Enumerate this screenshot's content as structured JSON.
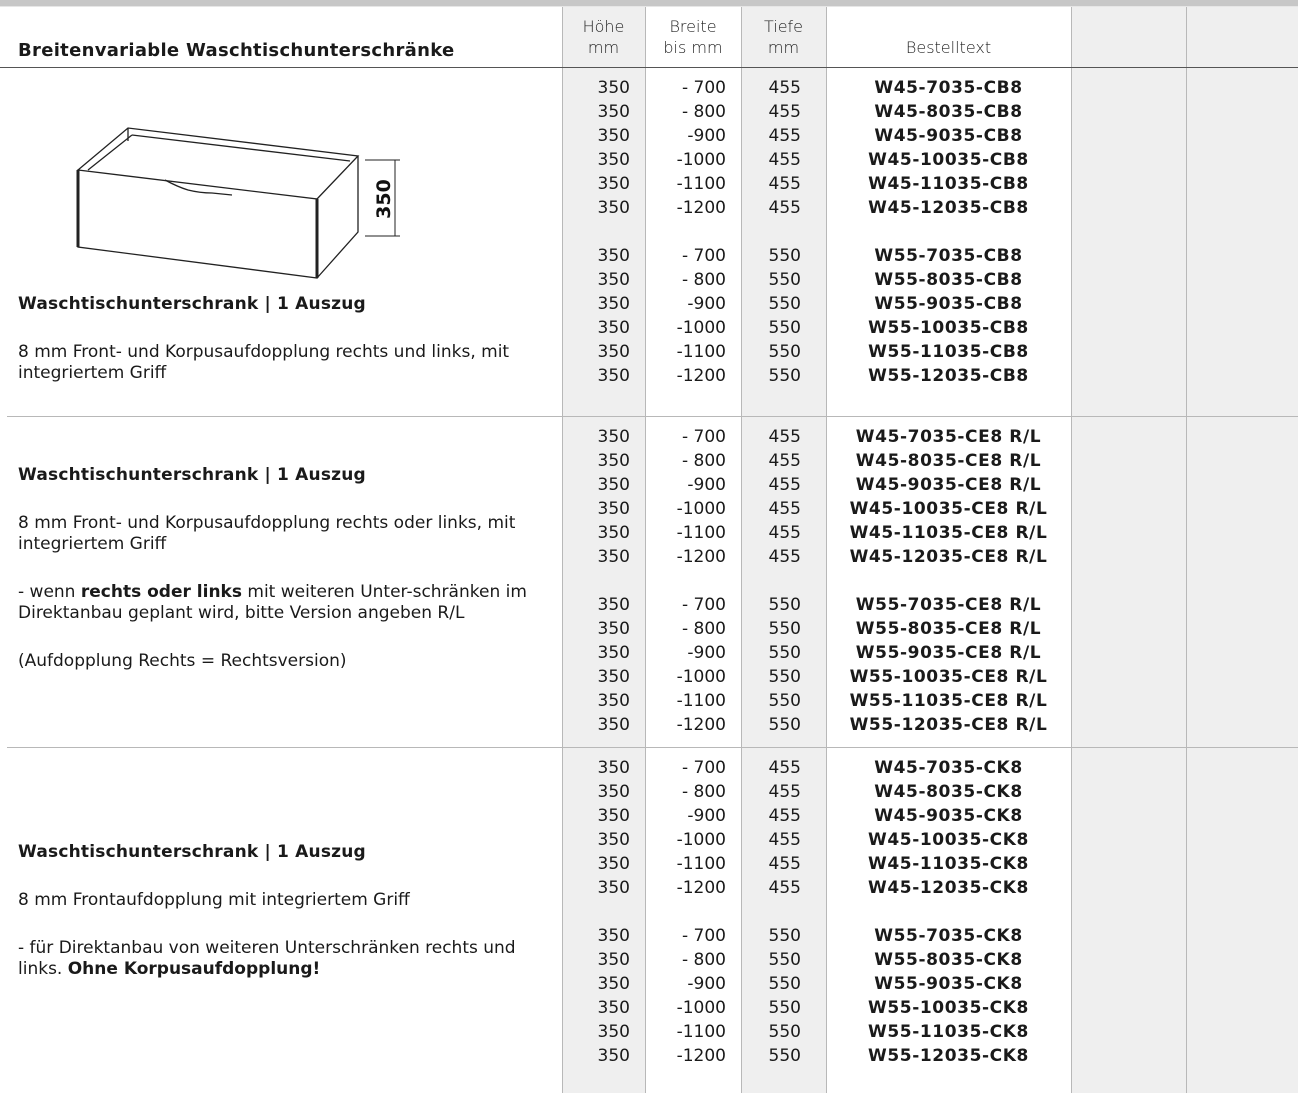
{
  "header": {
    "title": "Breitenvariable Waschtischunterschränke",
    "hoehe": [
      "Höhe",
      "mm"
    ],
    "breite": [
      "Breite",
      "bis mm"
    ],
    "tiefe": [
      "Tiefe",
      "mm"
    ],
    "bestelltext": "Bestelltext"
  },
  "drawing": {
    "dimension_label": "350"
  },
  "sections": [
    {
      "title": "Waschtischunterschrank | 1 Auszug",
      "para1": "8 mm Front- und Korpusaufdopplung rechts und links, mit integriertem Griff",
      "rows_a": [
        [
          "350",
          "- 700",
          "455",
          "W45-7035-CB8"
        ],
        [
          "350",
          "- 800",
          "455",
          "W45-8035-CB8"
        ],
        [
          "350",
          "-900",
          "455",
          "W45-9035-CB8"
        ],
        [
          "350",
          "-1000",
          "455",
          "W45-10035-CB8"
        ],
        [
          "350",
          "-1100",
          "455",
          "W45-11035-CB8"
        ],
        [
          "350",
          "-1200",
          "455",
          "W45-12035-CB8"
        ]
      ],
      "rows_b": [
        [
          "350",
          "- 700",
          "550",
          "W55-7035-CB8"
        ],
        [
          "350",
          "- 800",
          "550",
          "W55-8035-CB8"
        ],
        [
          "350",
          "-900",
          "550",
          "W55-9035-CB8"
        ],
        [
          "350",
          "-1000",
          "550",
          "W55-10035-CB8"
        ],
        [
          "350",
          "-1100",
          "550",
          "W55-11035-CB8"
        ],
        [
          "350",
          "-1200",
          "550",
          "W55-12035-CB8"
        ]
      ]
    },
    {
      "title": "Waschtischunterschrank | 1 Auszug",
      "para1": "8 mm Front- und Korpusaufdopplung rechts oder links, mit integriertem Griff",
      "para2_pre": "- wenn ",
      "para2_bold": "rechts oder links",
      "para2_post": " mit weiteren Unter-schränken im Direktanbau geplant wird, bitte Version angeben R/L",
      "para3": "(Aufdopplung Rechts = Rechtsversion)",
      "rows_a": [
        [
          "350",
          "- 700",
          "455",
          "W45-7035-CE8 R/L"
        ],
        [
          "350",
          "- 800",
          "455",
          "W45-8035-CE8 R/L"
        ],
        [
          "350",
          "-900",
          "455",
          "W45-9035-CE8 R/L"
        ],
        [
          "350",
          "-1000",
          "455",
          "W45-10035-CE8 R/L"
        ],
        [
          "350",
          "-1100",
          "455",
          "W45-11035-CE8 R/L"
        ],
        [
          "350",
          "-1200",
          "455",
          "W45-12035-CE8 R/L"
        ]
      ],
      "rows_b": [
        [
          "350",
          "- 700",
          "550",
          "W55-7035-CE8 R/L"
        ],
        [
          "350",
          "- 800",
          "550",
          "W55-8035-CE8 R/L"
        ],
        [
          "350",
          "-900",
          "550",
          "W55-9035-CE8 R/L"
        ],
        [
          "350",
          "-1000",
          "550",
          "W55-10035-CE8 R/L"
        ],
        [
          "350",
          "-1100",
          "550",
          "W55-11035-CE8 R/L"
        ],
        [
          "350",
          "-1200",
          "550",
          "W55-12035-CE8 R/L"
        ]
      ]
    },
    {
      "title": "Waschtischunterschrank | 1 Auszug",
      "para1": "8 mm Frontaufdopplung mit integriertem Griff",
      "para2_pre": "- für Direktanbau von weiteren Unterschränken rechts und links. ",
      "para2_bold": "Ohne Korpusaufdopplung!",
      "rows_a": [
        [
          "350",
          "- 700",
          "455",
          "W45-7035-CK8"
        ],
        [
          "350",
          "- 800",
          "455",
          "W45-8035-CK8"
        ],
        [
          "350",
          "-900",
          "455",
          "W45-9035-CK8"
        ],
        [
          "350",
          "-1000",
          "455",
          "W45-10035-CK8"
        ],
        [
          "350",
          "-1100",
          "455",
          "W45-11035-CK8"
        ],
        [
          "350",
          "-1200",
          "455",
          "W45-12035-CK8"
        ]
      ],
      "rows_b": [
        [
          "350",
          "- 700",
          "550",
          "W55-7035-CK8"
        ],
        [
          "350",
          "- 800",
          "550",
          "W55-8035-CK8"
        ],
        [
          "350",
          "-900",
          "550",
          "W55-9035-CK8"
        ],
        [
          "350",
          "-1000",
          "550",
          "W55-10035-CK8"
        ],
        [
          "350",
          "-1100",
          "550",
          "W55-11035-CK8"
        ],
        [
          "350",
          "-1200",
          "550",
          "W55-12035-CK8"
        ]
      ]
    }
  ]
}
